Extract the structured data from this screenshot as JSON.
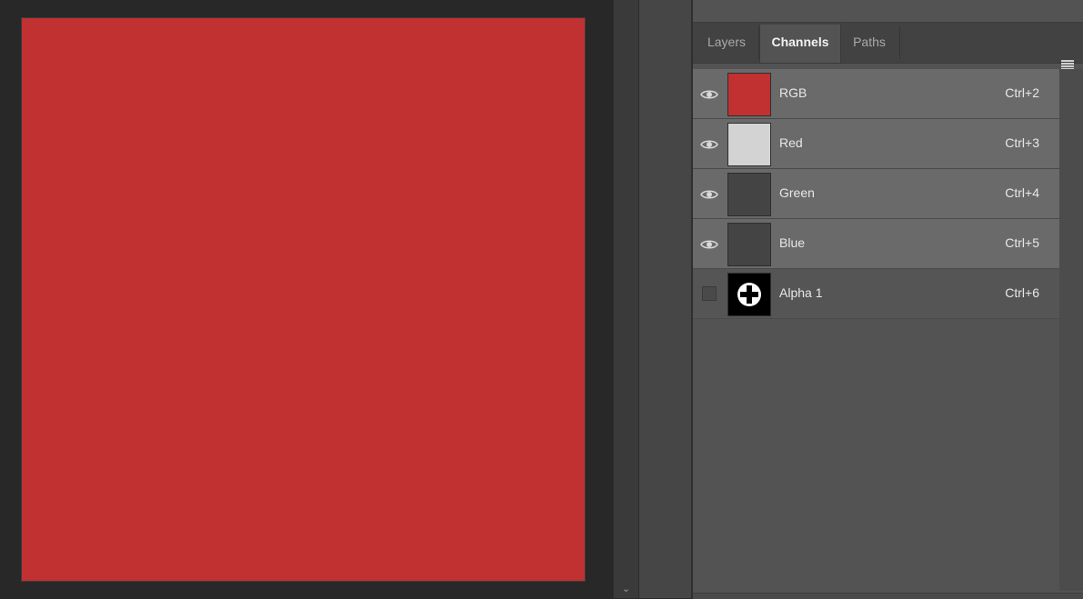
{
  "app": "Photoshop",
  "colors": {
    "canvas_fill": "#c13131",
    "rgb_thumb": "#c13131",
    "red_thumb": "#d3d3d3",
    "green_thumb": "#444444",
    "blue_thumb": "#444444",
    "alpha_thumb": "#000000"
  },
  "tabs": [
    {
      "label": "Layers",
      "active": false
    },
    {
      "label": "Channels",
      "active": true
    },
    {
      "label": "Paths",
      "active": false
    }
  ],
  "channels": [
    {
      "name": "RGB",
      "shortcut": "Ctrl+2",
      "visible": true,
      "thumb_color": "#c13131",
      "icon": "eye-icon"
    },
    {
      "name": "Red",
      "shortcut": "Ctrl+3",
      "visible": true,
      "thumb_color": "#d3d3d3",
      "icon": "eye-icon"
    },
    {
      "name": "Green",
      "shortcut": "Ctrl+4",
      "visible": true,
      "thumb_color": "#444444",
      "icon": "eye-icon"
    },
    {
      "name": "Blue",
      "shortcut": "Ctrl+5",
      "visible": true,
      "thumb_color": "#444444",
      "icon": "eye-icon"
    },
    {
      "name": "Alpha 1",
      "shortcut": "Ctrl+6",
      "visible": false,
      "thumb_color": "#000000",
      "icon": "plus-circle-icon"
    }
  ],
  "icons": {
    "panel_menu": "hamburger-menu-icon",
    "scroll_down": "chevron-down-icon"
  }
}
